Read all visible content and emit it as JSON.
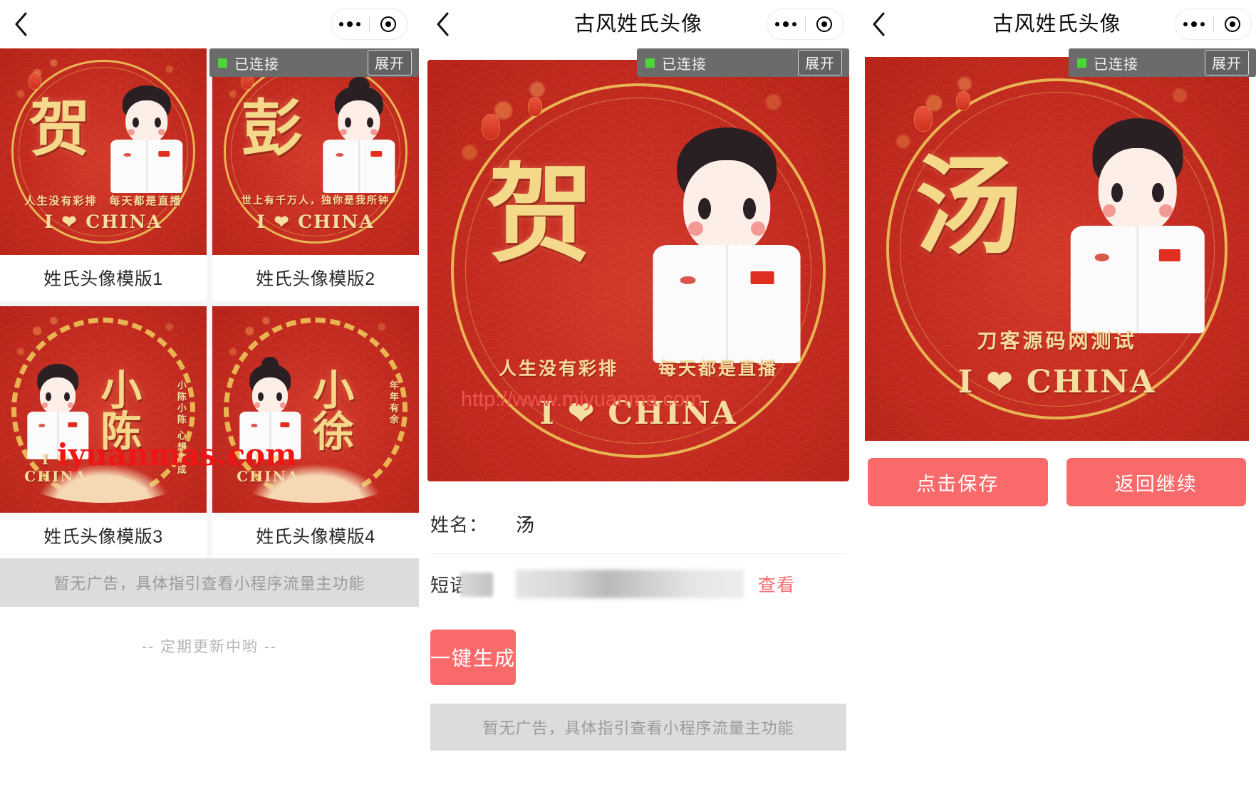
{
  "app": {
    "title": "古风姓氏头像",
    "brand_red": "#fa6a6a",
    "accent_gold": "#f4d98b"
  },
  "nav": {
    "back_icon": "chevron-left-icon",
    "menu_icon": "more-dots-icon",
    "target_icon": "target-circle-icon"
  },
  "debug_bar": {
    "status_label": "已连接",
    "expand_label": "展开",
    "status_color": "#4dd637"
  },
  "panel_a": {
    "templates": [
      {
        "label": "姓氏头像模版1",
        "surname": "贺",
        "slogan": "人生没有彩排　每天都是直播",
        "ilove": "I ❤ CHINA",
        "style": "classic",
        "gender": "male"
      },
      {
        "label": "姓氏头像模版2",
        "surname": "彭",
        "slogan": "世上有千万人，独你是我所钟",
        "ilove": "I ❤ CHINA",
        "style": "classic",
        "gender": "female"
      },
      {
        "label": "姓氏头像模版3",
        "surname": "小陈",
        "slogan": "小陈小陈 心想事成",
        "ilove": "I ❤ CHINA",
        "style": "noodle",
        "gender": "male"
      },
      {
        "label": "姓氏头像模版4",
        "surname": "小徐",
        "slogan": "年年有余",
        "ilove": "I ❤ CHINA",
        "style": "noodle",
        "gender": "female"
      }
    ],
    "ad_placeholder": "暂无广告，具体指引查看小程序流量主功能",
    "update_note": "-- 定期更新中哟 --",
    "watermark": "iyuanmas.com"
  },
  "panel_b": {
    "preview": {
      "surname": "贺",
      "slogan": "人生没有彩排　　每天都是直播",
      "ilove": "I ❤ CHINA"
    },
    "form": {
      "name_label": "姓名：",
      "name_value": "汤",
      "phrase_label": "短语：",
      "phrase_value": "",
      "view_link": "查看"
    },
    "generate_button": "一键生成",
    "ad_placeholder": "暂无广告，具体指引查看小程序流量主功能",
    "watermark_url": "http://www.miyuanma.com"
  },
  "panel_c": {
    "result": {
      "surname": "汤",
      "slogan": "刀客源码网测试",
      "ilove": "I ❤ CHINA"
    },
    "save_button": "点击保存",
    "back_button": "返回继续"
  }
}
